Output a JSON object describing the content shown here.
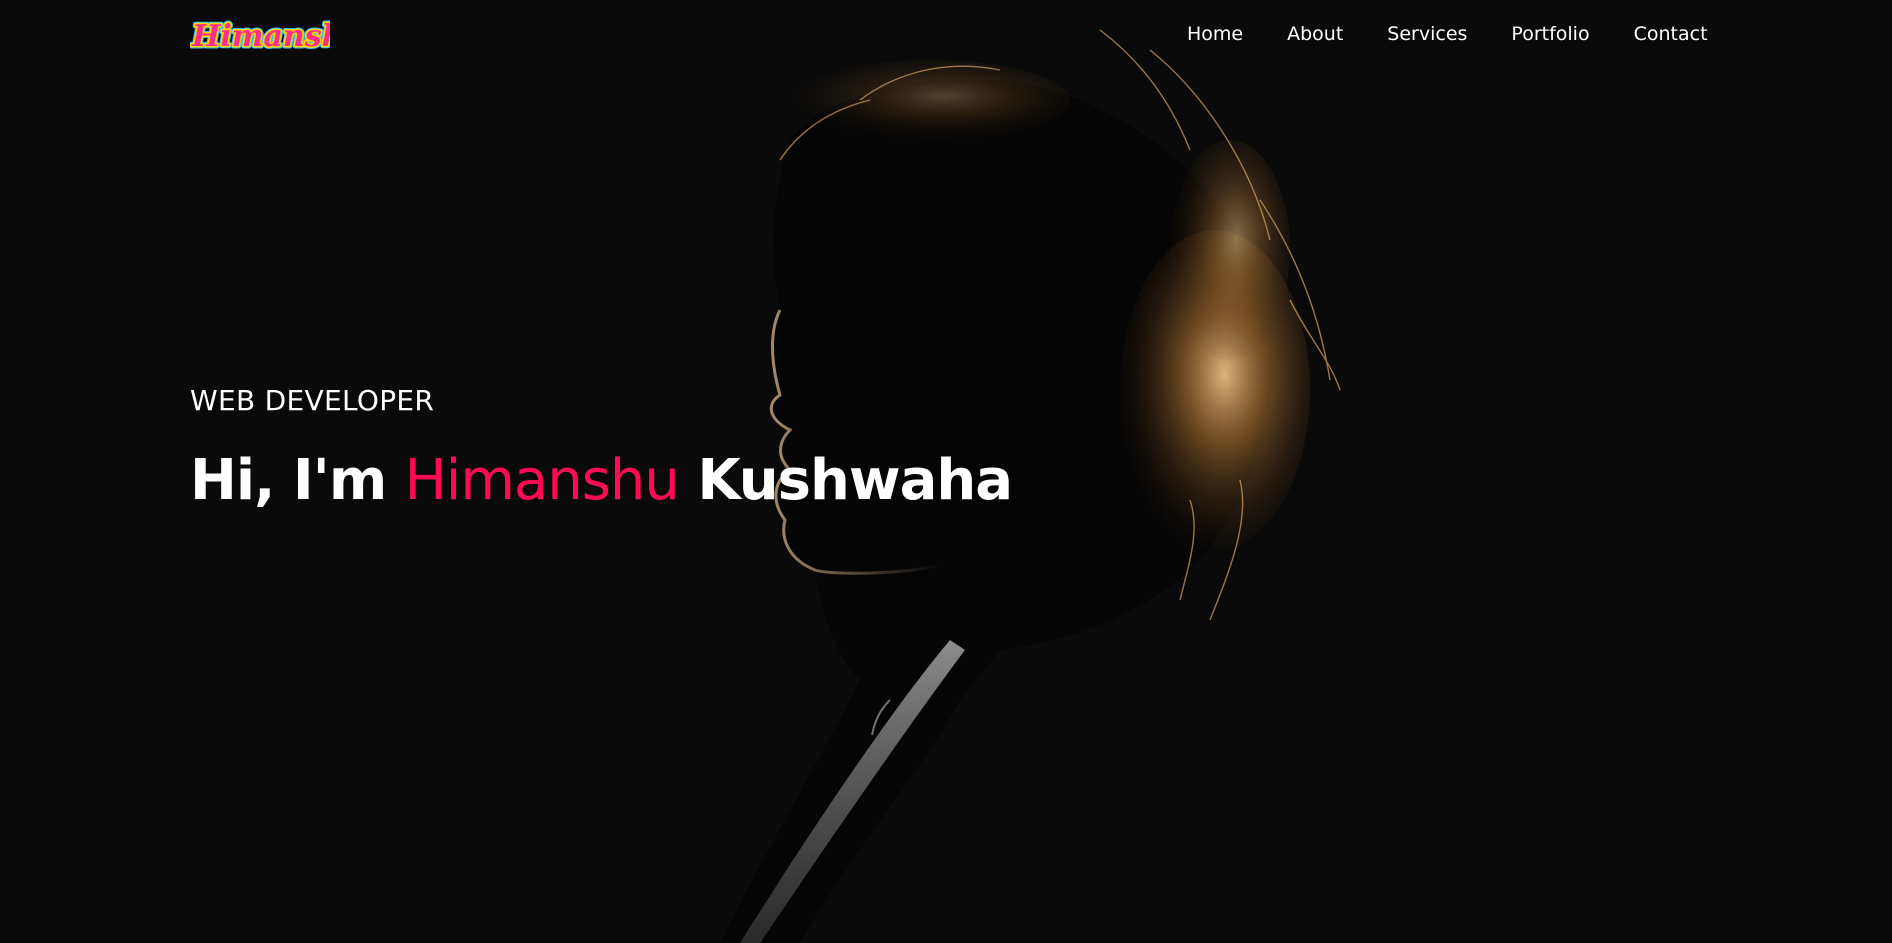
{
  "brand": {
    "logo_text": "Himanshu",
    "logo_colors": [
      "#ff2e88",
      "#ffd400",
      "#2ec5ff"
    ]
  },
  "nav": {
    "items": [
      {
        "label": "Home"
      },
      {
        "label": "About"
      },
      {
        "label": "Services"
      },
      {
        "label": "Portfolio"
      },
      {
        "label": "Contact"
      }
    ]
  },
  "hero": {
    "role": "WEB DEVELOPER",
    "greeting": "Hi, I'm",
    "first_name": "Himanshu",
    "last_name": "Kushwaha",
    "accent_color": "#ff0a54"
  },
  "theme": {
    "background": "#0a0a0a",
    "text": "#ffffff"
  }
}
